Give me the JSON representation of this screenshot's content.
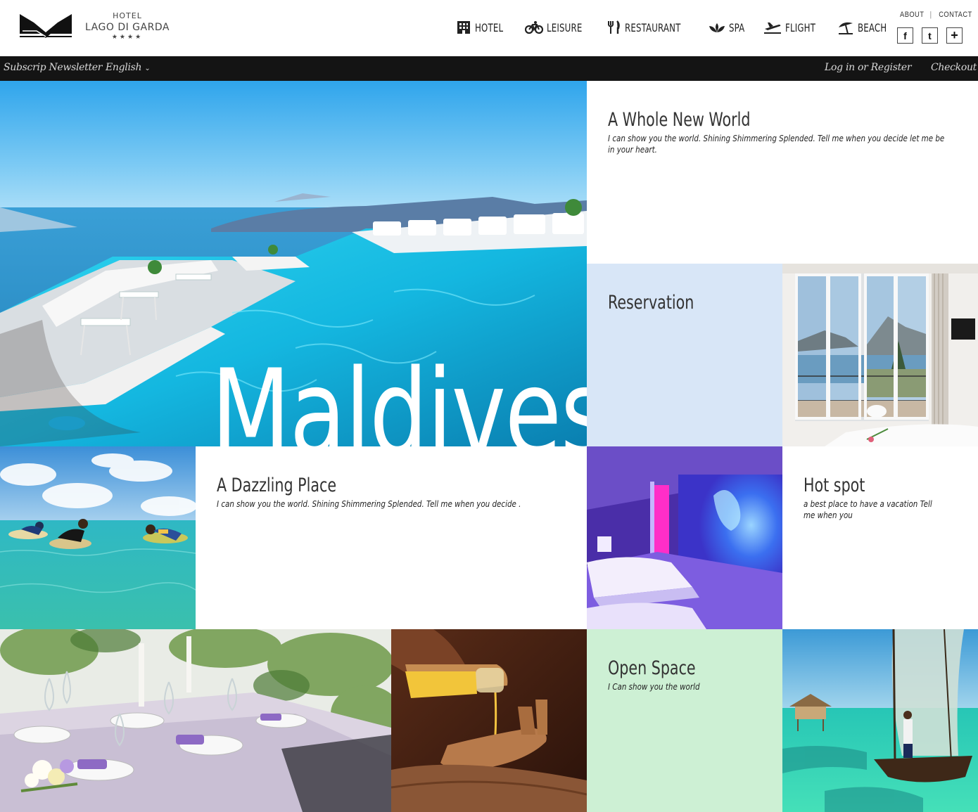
{
  "brand": {
    "hotel": "HOTEL",
    "name": "LAGO DI GARDA",
    "stars": "★★★★"
  },
  "nav": [
    {
      "label": "HOTEL",
      "icon": "building-icon"
    },
    {
      "label": "LEISURE",
      "icon": "bicycle-icon"
    },
    {
      "label": "RESTAURANT",
      "icon": "fork-knife-icon"
    },
    {
      "label": "SPA",
      "icon": "lotus-icon"
    },
    {
      "label": "FLIGHT",
      "icon": "airplane-icon"
    },
    {
      "label": "BEACH",
      "icon": "umbrella-icon"
    }
  ],
  "toplinks": {
    "about": "ABOUT",
    "contact": "CONTACT"
  },
  "social": {
    "facebook": "f",
    "twitter": "t",
    "plus": "+"
  },
  "bar": {
    "newsletter": "Subscrip Newsletter",
    "language": "English",
    "login": "Log in or Register",
    "checkout": "Checkout"
  },
  "hero": {
    "word": "Maldives"
  },
  "tiles": {
    "whole_world": {
      "title": "A Whole New World",
      "text": "I can show you the world. Shining Shimmering Splended. Tell me when you decide let me be in your heart."
    },
    "reservation": {
      "title": "Reservation"
    },
    "dazzling": {
      "title": "A Dazzling Place",
      "text": "I can show you the world. Shining Shimmering Splended. Tell me when you decide ."
    },
    "hotspot": {
      "title": "Hot spot",
      "text": "a best place to have a vacation Tell me when you"
    },
    "open_space": {
      "title": "Open Space",
      "text": "I Can show you the world"
    }
  },
  "colors": {
    "reservation_bg": "#d8e6f7",
    "open_space_bg": "#cdf0d4",
    "bar_bg": "#141414"
  }
}
